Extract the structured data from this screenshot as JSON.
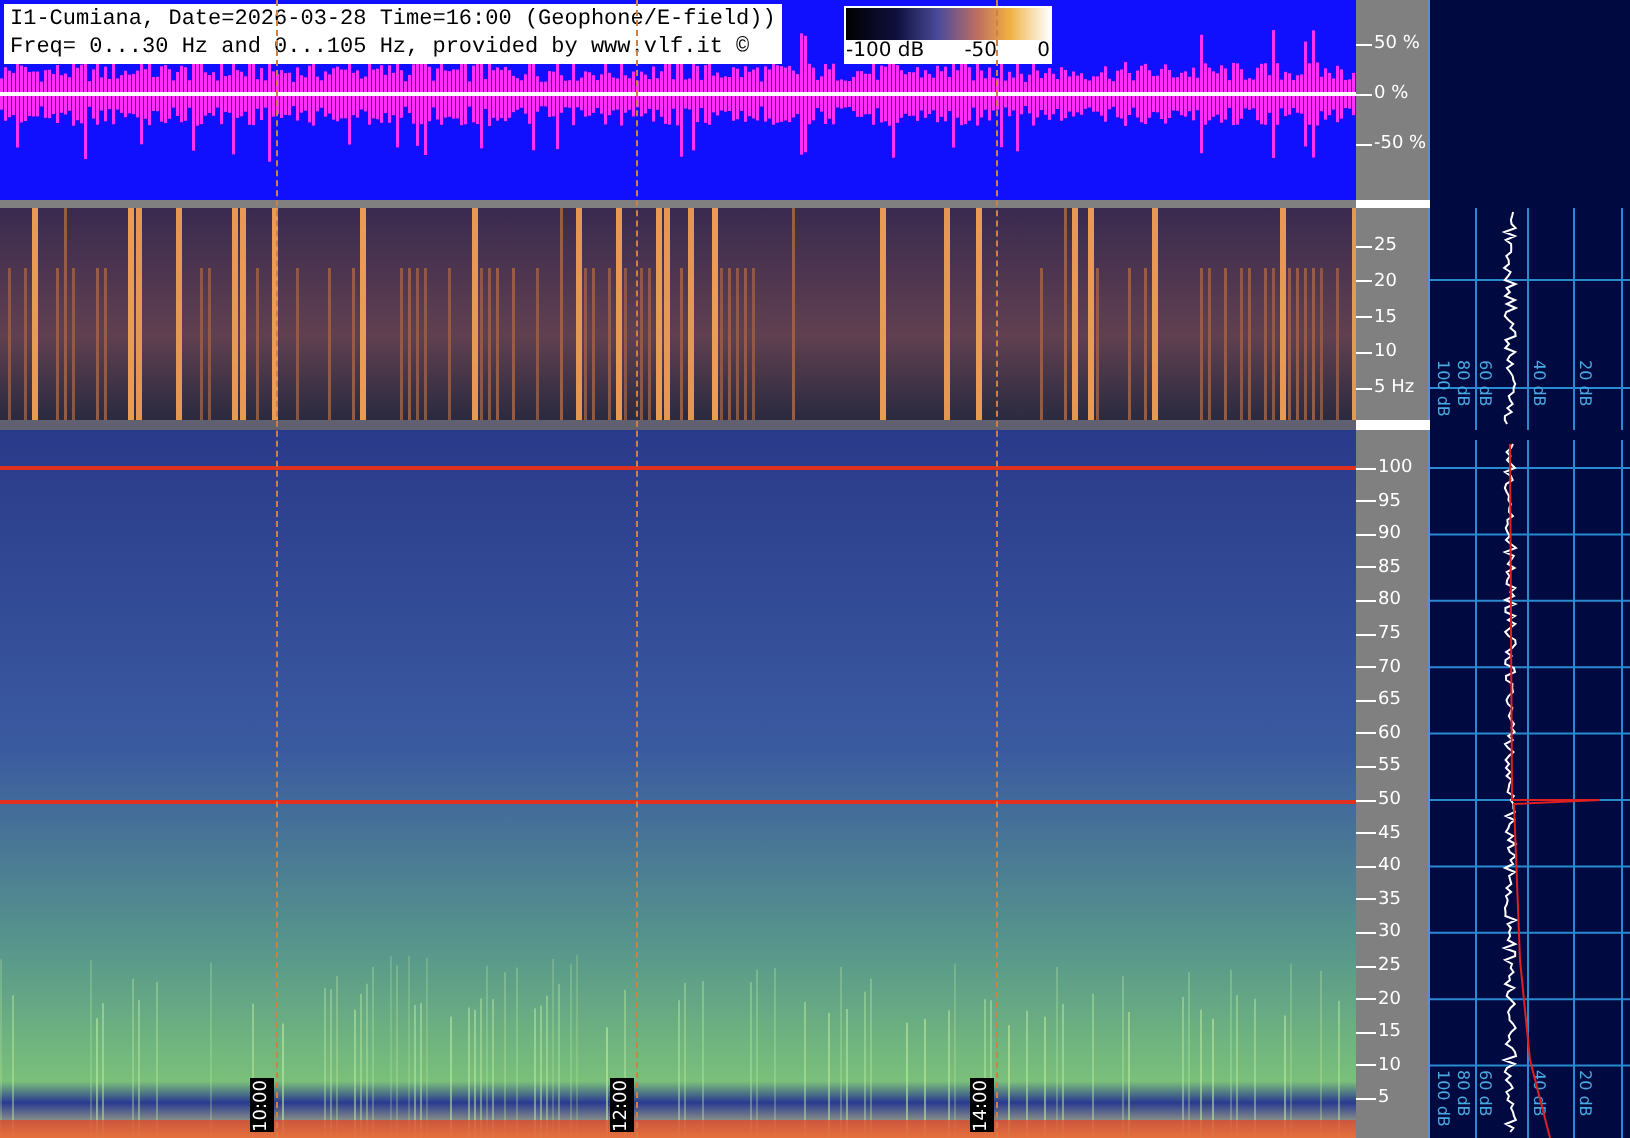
{
  "header": {
    "title_line": "I1-Cumiana, Date=2026-03-28 Time=16:00 (Geophone/E-field))",
    "freq_line": "Freq= 0...30 Hz and 0...105 Hz, provided by www.vlf.it ©"
  },
  "color_scale": {
    "labels": [
      "-100 dB",
      "-50",
      "0"
    ]
  },
  "waveform": {
    "axis_labels": [
      "50 %",
      "0 %",
      "-50 %"
    ]
  },
  "low_band": {
    "axis_labels": [
      "25",
      "20",
      "15",
      "10",
      "5 Hz"
    ],
    "db_labels": [
      "100 dB",
      "80 dB",
      "60 dB",
      "40 dB",
      "20 dB"
    ]
  },
  "high_band": {
    "axis_labels": [
      "100",
      "95",
      "90",
      "85",
      "80",
      "75",
      "70",
      "65",
      "60",
      "55",
      "50",
      "45",
      "40",
      "35",
      "30",
      "25",
      "20",
      "15",
      "10",
      "5"
    ],
    "db_labels": [
      "100 dB",
      "80 dB",
      "60 dB",
      "40 dB",
      "20 dB"
    ]
  },
  "time_markers": [
    "10:00",
    "12:00",
    "14:00"
  ]
}
